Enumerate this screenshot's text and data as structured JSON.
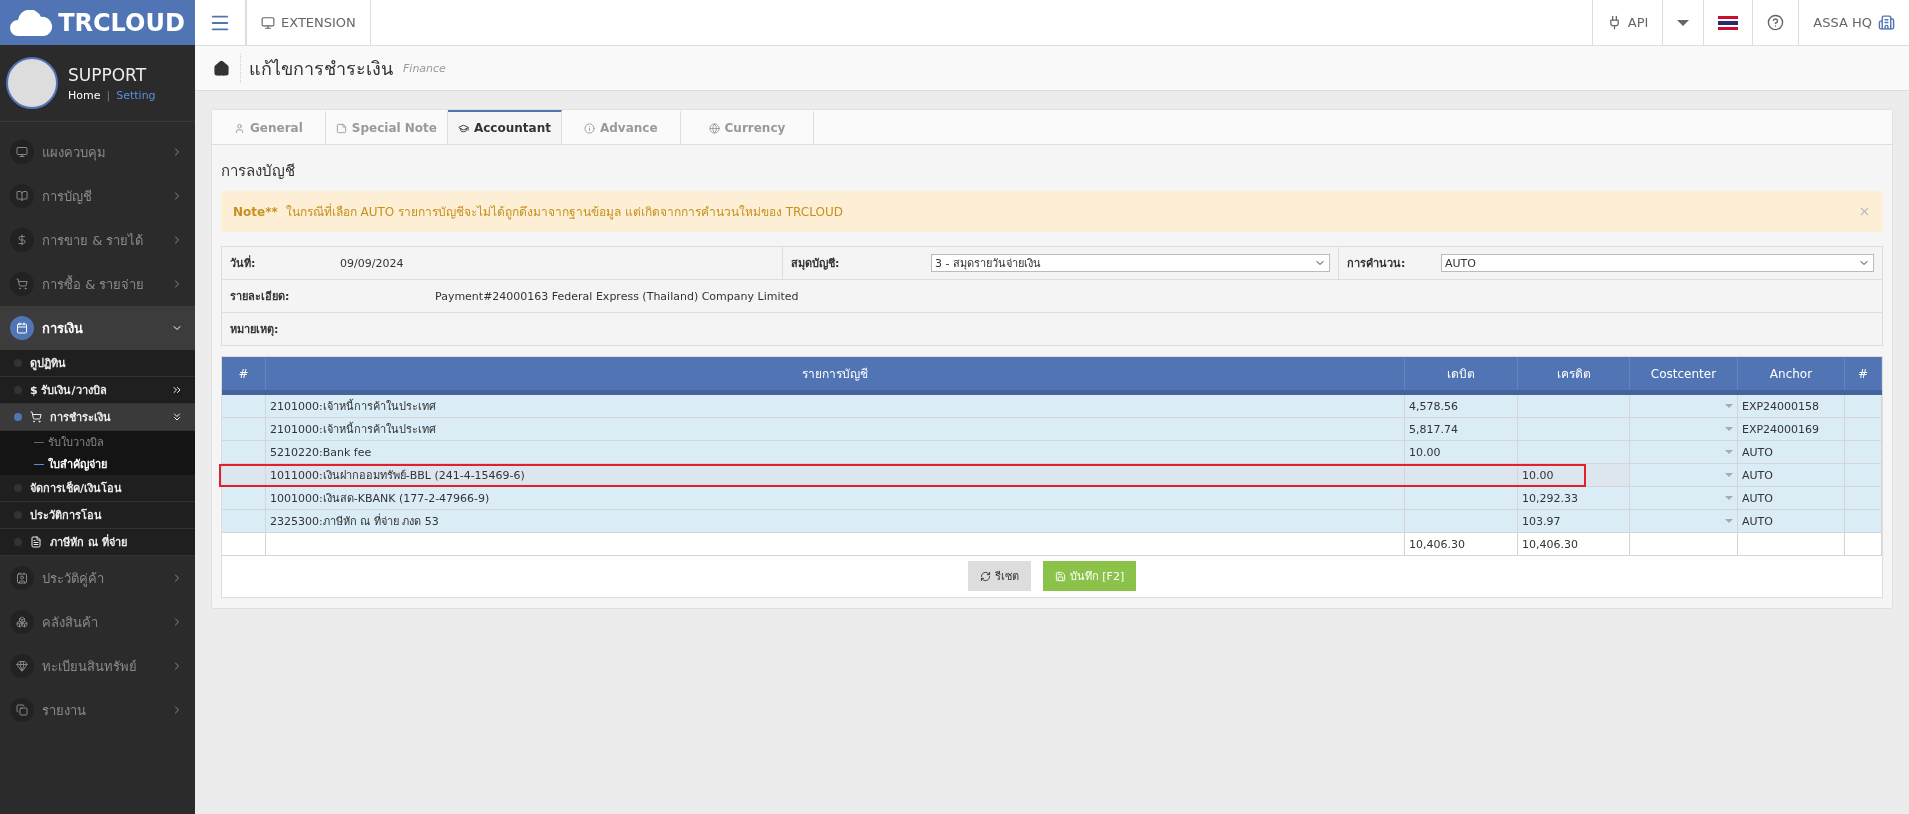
{
  "brand": {
    "logo_text": "TRCLOUD"
  },
  "topbar": {
    "extension": "EXTENSION",
    "api": "API",
    "company": "ASSA HQ"
  },
  "profile": {
    "name": "SUPPORT",
    "home": "Home",
    "separator": "|",
    "setting": "Setting"
  },
  "sidebar": {
    "items": [
      {
        "label": "แผงควบคุม",
        "selected": false,
        "expanded": false
      },
      {
        "label": "การบัญชี",
        "selected": false,
        "expanded": false
      },
      {
        "label": "การขาย & รายได้",
        "selected": false,
        "expanded": false
      },
      {
        "label": "การซื้อ & รายจ่าย",
        "selected": false,
        "expanded": false
      },
      {
        "label": "การเงิน",
        "selected": true,
        "expanded": true,
        "children": [
          {
            "label": "ดูปฏิทิน",
            "selected": false
          },
          {
            "label": "$ รับเงิน/วางบิล",
            "selected": false,
            "expanded": false
          },
          {
            "label": "การชำระเงิน",
            "selected": true,
            "expanded": true,
            "children": [
              {
                "label": "รับใบวางบิล",
                "selected": false
              },
              {
                "label": "ใบสำคัญจ่าย",
                "selected": true
              }
            ]
          },
          {
            "label": "จัดการเช็ค/เงินโอน",
            "selected": false
          },
          {
            "label": "ประวัติการโอน",
            "selected": false
          },
          {
            "label": "ภาษีหัก ณ ที่จ่าย",
            "selected": false
          }
        ]
      },
      {
        "label": "ประวัติคู่ค้า",
        "selected": false,
        "expanded": false
      },
      {
        "label": "คลังสินค้า",
        "selected": false,
        "expanded": false
      },
      {
        "label": "ทะเบียนสินทรัพย์",
        "selected": false,
        "expanded": false
      },
      {
        "label": "รายงาน",
        "selected": false,
        "expanded": false
      }
    ]
  },
  "page": {
    "title": "แก้ไขการชำระเงิน",
    "subtitle": "Finance"
  },
  "tabs": [
    {
      "label": "General",
      "selected": false
    },
    {
      "label": "Special Note",
      "selected": false
    },
    {
      "label": "Accountant",
      "selected": true
    },
    {
      "label": "Advance",
      "selected": false
    },
    {
      "label": "Currency",
      "selected": false
    }
  ],
  "section_title": "การลงบัญชี",
  "note": {
    "label": "Note**",
    "text": "ในกรณีที่เลือก AUTO รายการบัญชีจะไม่ได้ถูกดึงมาจากฐานข้อมูล แต่เกิดจากการคำนวนใหม่ของ TRCLOUD"
  },
  "form": {
    "date_label": "วันที่:",
    "date": "09/09/2024",
    "book_label": "สมุดบัญชี:",
    "book": "3 - สมุดรายวันจ่ายเงิน",
    "calc_label": "การคำนวน:",
    "calc": "AUTO",
    "detail_label": "รายละเอียด:",
    "detail": "Payment#24000163  Federal Express (Thailand) Company Limited",
    "remark_label": "หมายเหตุ:"
  },
  "table": {
    "columns": [
      "#",
      "รายการบัญชี",
      "เดบิต",
      "เครดิต",
      "Costcenter",
      "Anchor",
      "#"
    ],
    "rows": [
      {
        "account": "2101000:เจ้าหนี้การค้าในประเทศ",
        "debit": "4,578.56",
        "anchor": "EXP24000158",
        "highlighted": false
      },
      {
        "account": "2101000:เจ้าหนี้การค้าในประเทศ",
        "debit": "5,817.74",
        "anchor": "EXP24000169",
        "highlighted": false
      },
      {
        "account": "5210220:Bank fee",
        "debit": "10.00",
        "anchor": "AUTO",
        "highlighted": false
      },
      {
        "account": "1011000:เงินฝากออมทรัพย์-BBL (241-4-15469-6)",
        "credit": "10.00",
        "anchor": "AUTO",
        "highlighted": true
      },
      {
        "account": "1001000:เงินสด-KBANK (177-2-47966-9)",
        "credit": "10,292.33",
        "anchor": "AUTO",
        "highlighted": false
      },
      {
        "account": "2325300:ภาษีหัก ณ ที่จ่าย ภงด 53",
        "credit": "103.97",
        "anchor": "AUTO",
        "highlighted": false
      }
    ],
    "totals": {
      "debit": "10,406.30",
      "credit": "10,406.30"
    }
  },
  "buttons": {
    "reset": "รีเซต",
    "save": "บันทึก [F2]"
  }
}
